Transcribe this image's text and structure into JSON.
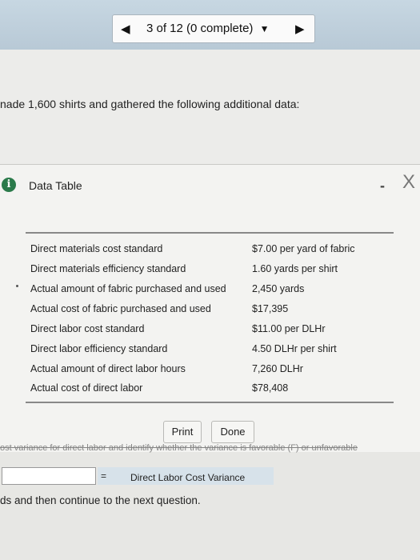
{
  "header": {
    "progress_label": "3 of 12 (0 complete)",
    "prev_arrow": "◀",
    "dropdown_arrow": "▼",
    "next_arrow": "▶"
  },
  "intro": {
    "text": "nade 1,600 shirts and gathered the following additional data:"
  },
  "dialog": {
    "info_icon": "i",
    "title": "Data Table",
    "minimize_icon": "-",
    "close_icon": "X",
    "rows": [
      {
        "label": "Direct materials cost standard",
        "value": "$7.00 per yard of fabric"
      },
      {
        "label": "Direct materials efficiency standard",
        "value": "1.60 yards per shirt"
      },
      {
        "label": "Actual amount of fabric purchased and used",
        "value": "2,450 yards"
      },
      {
        "label": "Actual cost of fabric purchased and used",
        "value": "$17,395"
      },
      {
        "label": "Direct labor cost standard",
        "value": "$11.00 per DLHr"
      },
      {
        "label": "Direct labor efficiency standard",
        "value": "4.50 DLHr per shirt"
      },
      {
        "label": "Actual amount of direct labor hours",
        "value": "7,260 DLHr"
      },
      {
        "label": "Actual cost of direct labor",
        "value": "$78,408"
      }
    ],
    "print_label": "Print",
    "done_label": "Done"
  },
  "work": {
    "strike_text": "ost variance for direct labor and identify whether the variance is favorable (F) or unfavorable",
    "equals": "=",
    "variance_label": "Direct Labor Cost Variance",
    "footer": "ds and then continue to the next question."
  }
}
